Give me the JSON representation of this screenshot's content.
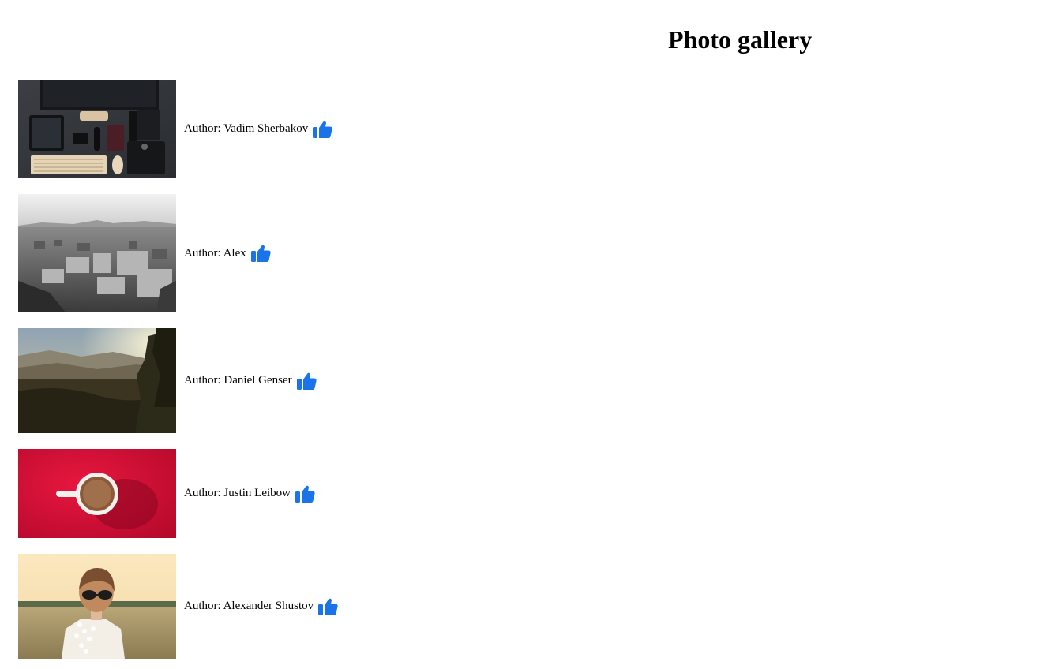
{
  "page": {
    "title": "Photo gallery"
  },
  "like_icon": {
    "name": "thumbs-up-icon",
    "color": "#1a73e8"
  },
  "photos": [
    {
      "author": "Author: Vadim Sherbakov",
      "subject": "desk-setup-photo"
    },
    {
      "author": "Author: Alex",
      "subject": "city-aerial-photo"
    },
    {
      "author": "Author: Daniel Genser",
      "subject": "sunset-landscape-photo"
    },
    {
      "author": "Author: Justin Leibow",
      "subject": "coffee-cup-photo"
    },
    {
      "author": "Author: Alexander Shustov",
      "subject": "portrait-field-photo"
    }
  ]
}
